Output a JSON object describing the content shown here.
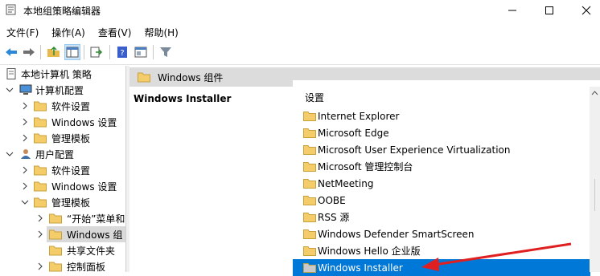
{
  "window": {
    "title": "本地组策略编辑器"
  },
  "menu": [
    "文件(F)",
    "操作(A)",
    "查看(V)",
    "帮助(H)"
  ],
  "tree": {
    "root": "本地计算机 策略",
    "computer_config": "计算机配置",
    "cc_software": "软件设置",
    "cc_windows": "Windows 设置",
    "cc_templates": "管理模板",
    "user_config": "用户配置",
    "uc_software": "软件设置",
    "uc_windows": "Windows 设置",
    "uc_templates": "管理模板",
    "start_menu": "“开始”菜单和",
    "windows_components": "Windows 组",
    "shared_folders": "共享文件夹",
    "control_panel": "控制面板"
  },
  "content": {
    "header": "Windows 组件",
    "detail_title": "Windows Installer",
    "column_header": "设置",
    "items": [
      "Internet Explorer",
      "Microsoft Edge",
      "Microsoft User Experience Virtualization",
      "Microsoft 管理控制台",
      "NetMeeting",
      "OOBE",
      "RSS 源",
      "Windows Defender SmartScreen",
      "Windows Hello 企业版",
      "Windows Installer"
    ],
    "selected_index": 9
  },
  "colors": {
    "selection": "#0078d7",
    "folder": "#e8b84a",
    "annotation_arrow": "#e02020"
  }
}
